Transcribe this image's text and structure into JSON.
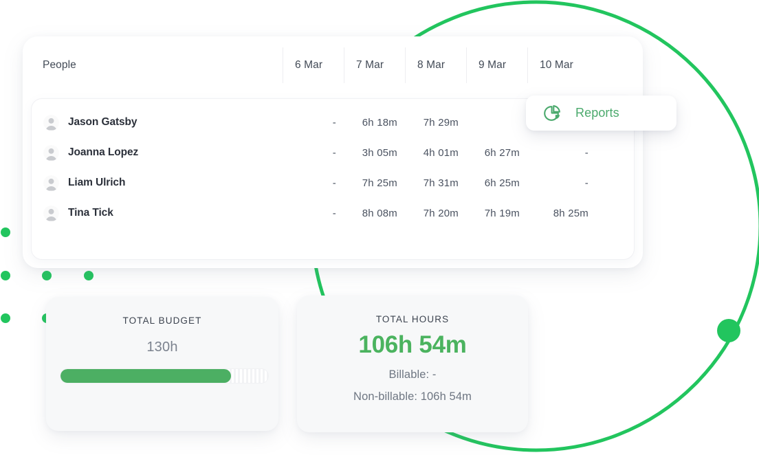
{
  "theme": {
    "accent_green": "#22c55e",
    "progress_green": "#4caf63",
    "hours_green": "#4bb35f",
    "reports_green": "#4aa96c",
    "card_bg": "#f7f8f9",
    "text_dark": "#2b303a",
    "text_muted": "#6e7682"
  },
  "table": {
    "columns": {
      "people_header": "People",
      "dates": [
        "6 Mar",
        "7 Mar",
        "8 Mar",
        "9 Mar",
        "10 Mar"
      ]
    },
    "rows": [
      {
        "name": "Jason Gatsby",
        "avatar_icon": "user-avatar-icon",
        "values": [
          "-",
          "6h 18m",
          "7h 29m",
          "",
          ""
        ]
      },
      {
        "name": "Joanna Lopez",
        "avatar_icon": "user-avatar-icon",
        "values": [
          "-",
          "3h 05m",
          "4h 01m",
          "6h 27m",
          "-"
        ]
      },
      {
        "name": "Liam Ulrich",
        "avatar_icon": "user-avatar-icon",
        "values": [
          "-",
          "7h 25m",
          "7h 31m",
          "6h 25m",
          "-"
        ]
      },
      {
        "name": "Tina Tick",
        "avatar_icon": "user-avatar-icon",
        "values": [
          "-",
          "8h 08m",
          "7h 20m",
          "7h 19m",
          "8h 25m"
        ]
      }
    ]
  },
  "reports_pill": {
    "label": "Reports",
    "icon": "pie-chart-icon"
  },
  "budget_card": {
    "title": "TOTAL BUDGET",
    "value": "130h",
    "progress_percent": 82
  },
  "hours_card": {
    "title": "TOTAL HOURS",
    "value": "106h 54m",
    "billable": "Billable: -",
    "non_billable": "Non-billable: 106h 54m"
  },
  "decor": {
    "arc_color": "#22c55e",
    "dot_color": "#22c55e",
    "knob_label": "circle-progress-knob"
  }
}
